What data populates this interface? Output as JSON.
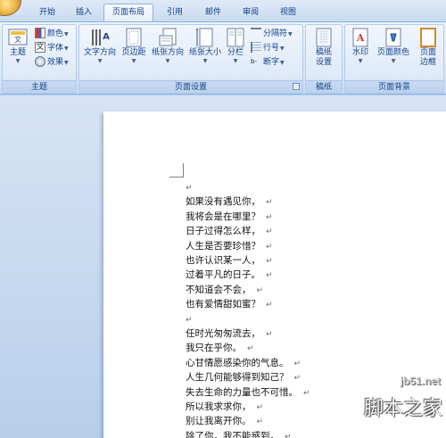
{
  "tabs": [
    {
      "label": "开始"
    },
    {
      "label": "插入"
    },
    {
      "label": "页面布局"
    },
    {
      "label": "引用"
    },
    {
      "label": "邮件"
    },
    {
      "label": "审阅"
    },
    {
      "label": "视图"
    }
  ],
  "ribbon": {
    "groups": {
      "theme": {
        "label": "主题",
        "theme_button": "主题",
        "colors": "颜色",
        "fonts": "字体",
        "effects": "效果"
      },
      "page_setup": {
        "label": "页面设置",
        "text_direction": "文字方向",
        "margins": "页边距",
        "orientation": "纸张方向",
        "size": "纸张大小",
        "columns": "分栏",
        "breaks": "分隔符",
        "line_numbers": "行号",
        "hyphenation": "断字"
      },
      "draft": {
        "label": "稿纸",
        "draft_settings_1": "稿纸",
        "draft_settings_2": "设置"
      },
      "page_background": {
        "label": "页面背景",
        "watermark": "水印",
        "page_color": "页面颜色",
        "page_borders_1": "页面",
        "page_borders_2": "边框"
      }
    }
  },
  "document": {
    "para_mark": "↵",
    "lines": [
      "",
      "如果没有遇见你，",
      "我将会是在哪里？",
      "日子过得怎么样，",
      "人生是否要珍惜？",
      "也许认识某一人，",
      "过着平凡的日子。",
      "不知道会不会，",
      "也有爱情甜如蜜？",
      "",
      "任时光匆匆流去，",
      "我只在乎你。",
      "心甘情愿感染你的气息。",
      "人生几何能够得到知己？",
      "失去生命的力量也不可惜。",
      "所以我求求你，",
      "别让我离开你。",
      "除了你，我不能感到，"
    ]
  },
  "watermark": {
    "site": "jb51.net",
    "brand": "脚本之家"
  },
  "colors": {
    "ribbon_text": "#15428b",
    "ribbon_border": "#8db2e3"
  }
}
